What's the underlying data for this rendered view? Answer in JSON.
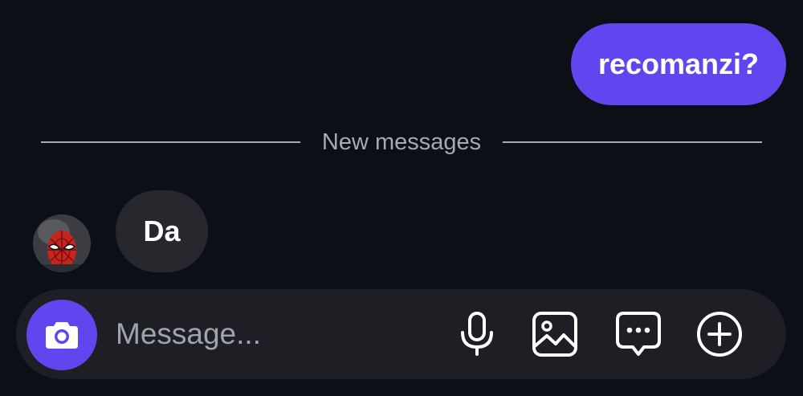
{
  "conversation": {
    "messages": [
      {
        "direction": "outgoing",
        "text": "recomanzi?"
      },
      {
        "direction": "incoming",
        "text": "Da",
        "avatar_icon": "spiderman-avatar"
      }
    ],
    "new_messages_divider": "New messages"
  },
  "composer": {
    "placeholder": "Message...",
    "icons": [
      "camera-icon",
      "microphone-icon",
      "gallery-icon",
      "sticker-chat-icon",
      "plus-circle-icon"
    ]
  },
  "colors": {
    "background": "#0c0f16",
    "accent": "#6146f0",
    "incoming_bubble": "#26282e",
    "composer": "#1d1f25",
    "muted_text": "#a6a9b6"
  }
}
